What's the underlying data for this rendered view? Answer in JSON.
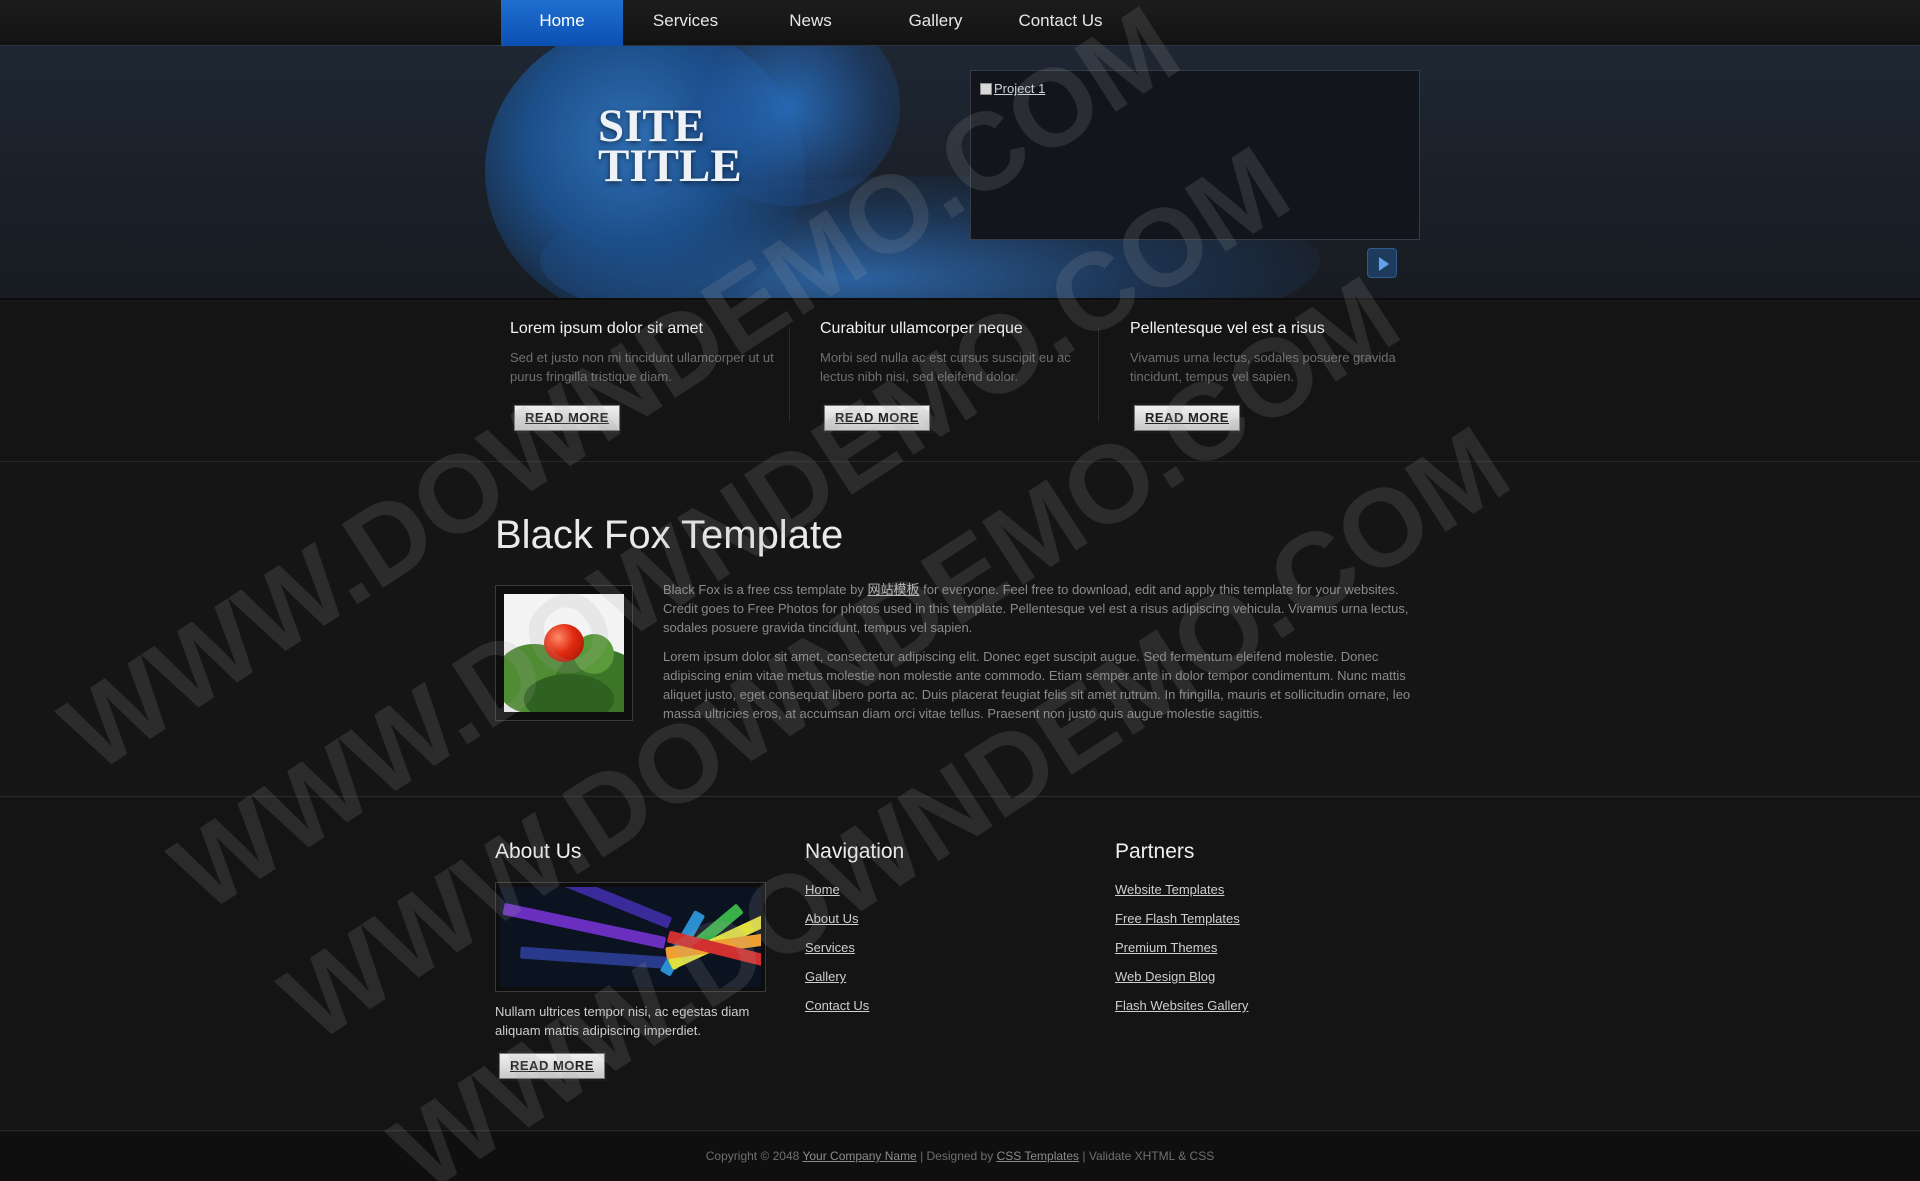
{
  "nav": {
    "items": [
      {
        "label": "Home",
        "active": true
      },
      {
        "label": "Services"
      },
      {
        "label": "News"
      },
      {
        "label": "Gallery"
      },
      {
        "label": "Contact Us"
      }
    ]
  },
  "header": {
    "site_title": "SITE\nTITLE",
    "slider_image_alt": "Project 1",
    "play_icon": "play-icon"
  },
  "features": [
    {
      "title": "Lorem ipsum dolor sit amet",
      "text": "Sed et justo non mi tincidunt ullamcorper ut ut purus fringilla tristique diam.",
      "button": "READ MORE"
    },
    {
      "title": "Curabitur ullamcorper neque",
      "text": "Morbi sed nulla ac est cursus suscipit eu ac lectus nibh nisi, sed eleifend dolor.",
      "button": "READ MORE"
    },
    {
      "title": "Pellentesque vel est a risus",
      "text": "Vivamus urna lectus, sodales posuere gravida tincidunt, tempus vel sapien.",
      "button": "READ MORE"
    }
  ],
  "main": {
    "title": "Black Fox Template",
    "p1_before": "Black Fox is a free css template by ",
    "p1_link": "网站模板",
    "p1_after": " for everyone. Feel free to download, edit and apply this template for your websites. Credit goes to Free Photos for photos used in this template. Pellentesque vel est a risus adipiscing vehicula. Vivamus urna lectus, sodales posuere gravida tincidunt, tempus vel sapien.",
    "p2": "Lorem ipsum dolor sit amet, consectetur adipiscing elit. Donec eget suscipit augue. Sed fermentum eleifend molestie. Donec adipiscing enim vitae metus molestie non molestie ante commodo. Etiam semper ante in dolor tempor condimentum. Nunc mattis aliquet justo, eget consequat libero porta ac. Duis placerat feugiat felis sit amet rutrum. In fringilla, mauris et sollicitudin ornare, leo massa ultricies eros, at accumsan diam orci vitae tellus. Praesent non justo quis augue molestie sagittis."
  },
  "footer": {
    "about": {
      "heading": "About Us",
      "text": "Nullam ultrices tempor nisi, ac egestas diam aliquam mattis adipiscing imperdiet.",
      "button": "READ MORE"
    },
    "navigation": {
      "heading": "Navigation",
      "links": [
        "Home",
        "About Us",
        "Services",
        "Gallery",
        "Contact Us"
      ]
    },
    "partners": {
      "heading": "Partners",
      "links": [
        "Website Templates",
        "Free Flash Templates",
        "Premium Themes",
        "Web Design Blog",
        "Flash Websites Gallery"
      ]
    }
  },
  "copyright": {
    "prefix": "Copyright © 2048 ",
    "company": "Your Company Name",
    "middle": " | Designed by ",
    "designer": "CSS Templates",
    "suffix": " | Validate XHTML & CSS"
  },
  "watermark": "WWW.DOWNDEMO.COM"
}
